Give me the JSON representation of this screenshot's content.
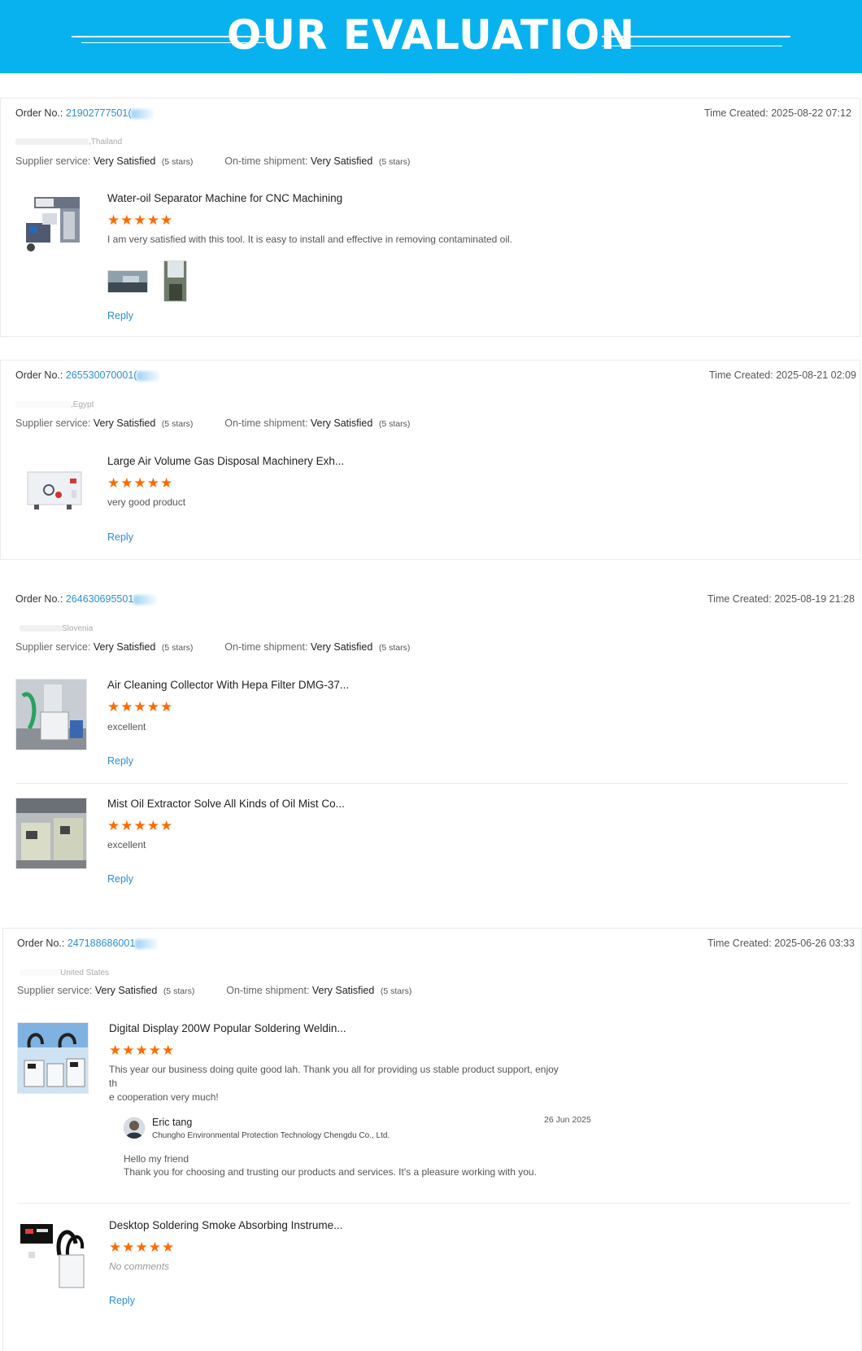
{
  "banner": {
    "title": "OUR EVALUATION"
  },
  "labels": {
    "order_no": "Order No.:",
    "time_created": "Time Created:",
    "supplier_service": "Supplier service:",
    "ontime_shipment": "On-time shipment:",
    "reply": "Reply"
  },
  "colors": {
    "banner": "#08b2ef",
    "link": "#2a8fd8",
    "star": "#ff6a00"
  },
  "orders": [
    {
      "order_no": "21902777501(",
      "time_created": "2025-08-22 07:12",
      "country": ",Thailand",
      "supplier_rating": "Very Satisfied",
      "supplier_stars": "(5 stars)",
      "shipment_rating": "Very Satisfied",
      "shipment_stars": "(5 stars)",
      "products": [
        {
          "title": "Water-oil Separator Machine for CNC Machining",
          "stars": "★★★★★",
          "rating": 5,
          "comment": "I am very satisfied with this tool. It is easy to install and effective in removing contaminated oil."
        }
      ]
    },
    {
      "order_no": "265530070001(",
      "time_created": "2025-08-21 02:09",
      "country": ",Egypt",
      "supplier_rating": "Very Satisfied",
      "supplier_stars": "(5 stars)",
      "shipment_rating": "Very Satisfied",
      "shipment_stars": "(5 stars)",
      "products": [
        {
          "title": "Large Air Volume Gas Disposal Machinery Exh...",
          "stars": "★★★★★",
          "rating": 5,
          "comment": "very good product"
        }
      ]
    },
    {
      "order_no": "264630695501",
      "time_created": "2025-08-19 21:28",
      "country": "Slovenia",
      "supplier_rating": "Very Satisfied",
      "supplier_stars": "(5 stars)",
      "shipment_rating": "Very Satisfied",
      "shipment_stars": "(5 stars)",
      "products": [
        {
          "title": "Air Cleaning Collector With Hepa Filter DMG-37...",
          "stars": "★★★★★",
          "rating": 5,
          "comment": "excellent"
        },
        {
          "title": "Mist Oil Extractor Solve All Kinds of Oil Mist Co...",
          "stars": "★★★★★",
          "rating": 5,
          "comment": "excellent"
        }
      ]
    },
    {
      "order_no": "247188686001",
      "time_created": "2025-06-26 03:33",
      "country": "United States",
      "supplier_rating": "Very Satisfied",
      "supplier_stars": "(5 stars)",
      "shipment_rating": "Very Satisfied",
      "shipment_stars": "(5 stars)",
      "products": [
        {
          "title": "Digital Display 200W Popular Soldering Weldin...",
          "stars": "★★★★★",
          "rating": 5,
          "comment_line1": "This year our business doing quite good lah. Thank you all for providing us stable product support, enjoy th",
          "comment_line2": "e cooperation very much!",
          "seller_reply": {
            "name": "Eric tang",
            "company": "Chungho Environmental Protection Technology Chengdu Co., Ltd.",
            "date": "26 Jun 2025",
            "line1": "Hello my friend",
            "line2": "Thank you for choosing and trusting our products and services. It's a pleasure working with you."
          }
        },
        {
          "title": "Desktop Soldering Smoke Absorbing Instrume...",
          "stars": "★★★★★",
          "rating": 5,
          "comment": "No comments"
        }
      ]
    }
  ]
}
